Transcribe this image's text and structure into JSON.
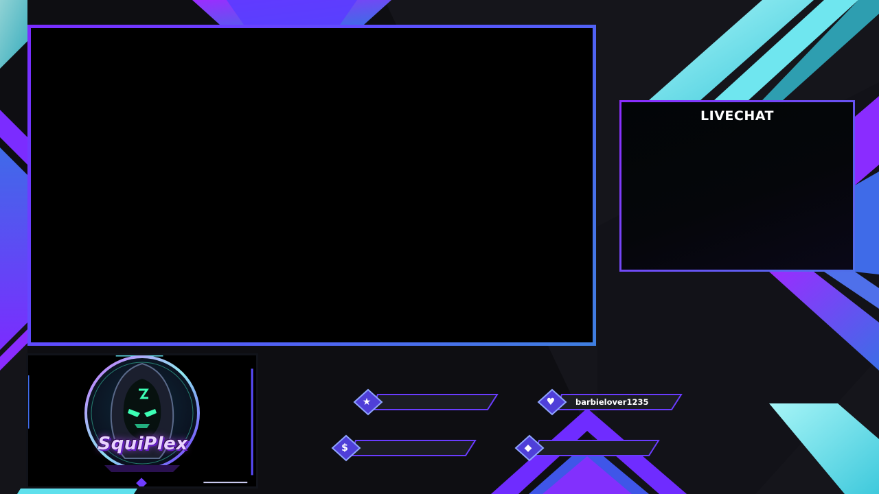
{
  "livechat": {
    "title": "LIVECHAT"
  },
  "brand": {
    "name": "SquiPlex",
    "logo_icon": "hooded-figure-emblem"
  },
  "alerts": [
    {
      "id": "latest-follower",
      "icon": "star-icon",
      "glyph": "★",
      "value": ""
    },
    {
      "id": "latest-subscriber",
      "icon": "heart-icon",
      "glyph": "♥",
      "value": "barbielover1235"
    },
    {
      "id": "latest-donation",
      "icon": "dollar-icon",
      "glyph": "$",
      "value": ""
    },
    {
      "id": "latest-cheer",
      "icon": "diamond-icon",
      "glyph": "◆",
      "value": ""
    }
  ],
  "colors": {
    "accent_purple": "#7a2cff",
    "accent_blue": "#4d6fe8",
    "accent_cyan": "#5fe0ec",
    "background": "#0d0d10"
  }
}
